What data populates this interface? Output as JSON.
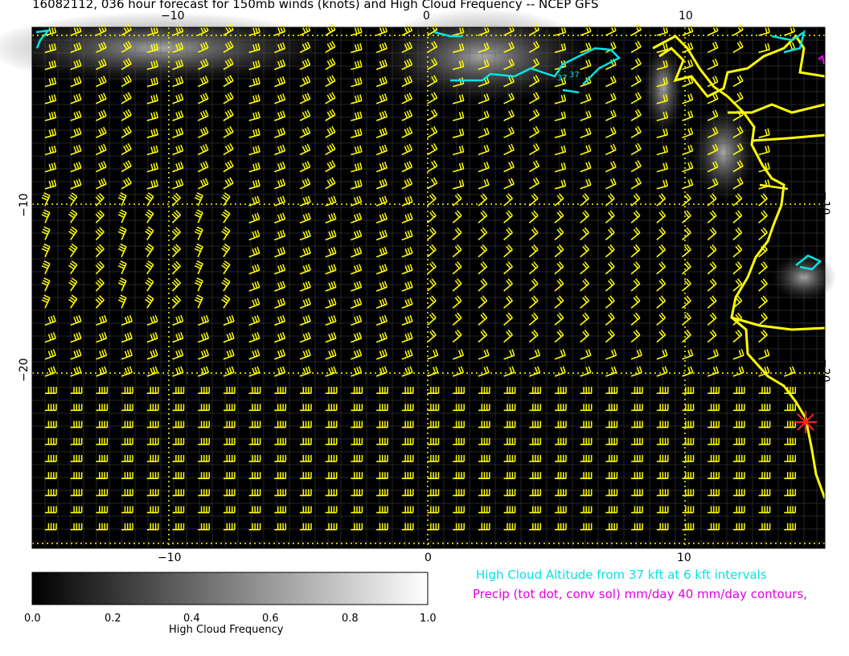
{
  "title": "16082112, 036 hour forecast for 150mb winds (knots) and High Cloud Frequency -- NCEP GFS",
  "axes": {
    "top_ticks": [
      "−10",
      "0",
      "10"
    ],
    "bottom_ticks": [
      "−10",
      "0",
      "10"
    ],
    "left_ticks": [
      "−10",
      "−20"
    ],
    "right_ticks": [
      "−10",
      "−20"
    ],
    "lon_range": [
      -15.5,
      15.5
    ],
    "lat_range": [
      -29.8,
      0.5
    ]
  },
  "colorbar": {
    "ticks": [
      "0.0",
      "0.2",
      "0.4",
      "0.6",
      "0.8",
      "1.0"
    ],
    "label": "High Cloud Frequency"
  },
  "annotations": {
    "cloud_altitude": "High Cloud Altitude from 37 kft at 6 kft intervals",
    "precip": "Precip (tot dot, conv sol) mm/day 40 mm/day contours,"
  },
  "contour_labels": [
    "37",
    "37"
  ],
  "colors": {
    "map_background": "#000000",
    "wind_barbs": "#ffff00",
    "coastline": "#ffff00",
    "cloud_altitude_contour": "#00e5e5",
    "precip_contour": "#e000e0",
    "marker": "#ff2020",
    "grid": "#ffff00"
  },
  "marker_icon": "red-star-icon"
}
